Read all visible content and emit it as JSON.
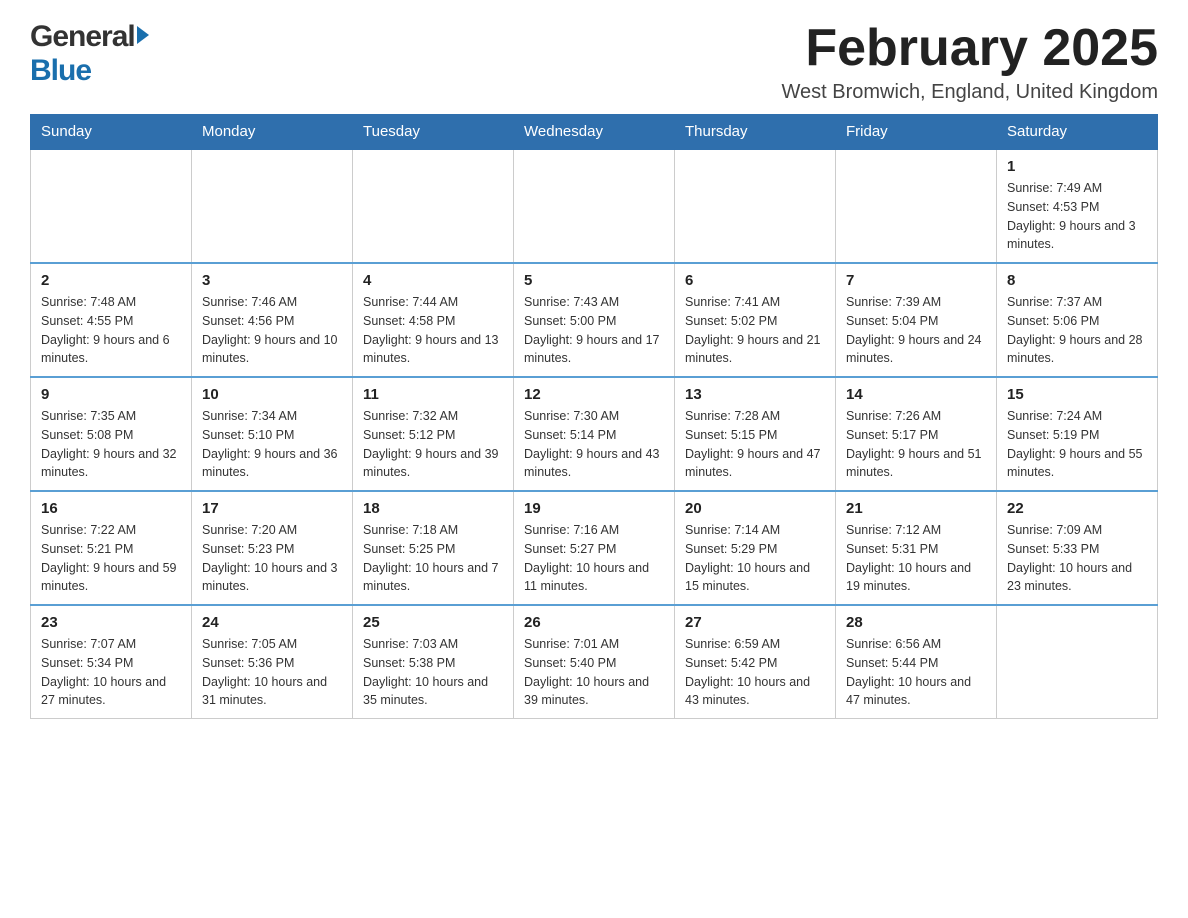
{
  "header": {
    "logo_general": "General",
    "logo_blue": "Blue",
    "month_title": "February 2025",
    "location": "West Bromwich, England, United Kingdom"
  },
  "days_of_week": [
    "Sunday",
    "Monday",
    "Tuesday",
    "Wednesday",
    "Thursday",
    "Friday",
    "Saturday"
  ],
  "weeks": [
    {
      "days": [
        {
          "number": "",
          "info": ""
        },
        {
          "number": "",
          "info": ""
        },
        {
          "number": "",
          "info": ""
        },
        {
          "number": "",
          "info": ""
        },
        {
          "number": "",
          "info": ""
        },
        {
          "number": "",
          "info": ""
        },
        {
          "number": "1",
          "info": "Sunrise: 7:49 AM\nSunset: 4:53 PM\nDaylight: 9 hours and 3 minutes."
        }
      ]
    },
    {
      "days": [
        {
          "number": "2",
          "info": "Sunrise: 7:48 AM\nSunset: 4:55 PM\nDaylight: 9 hours and 6 minutes."
        },
        {
          "number": "3",
          "info": "Sunrise: 7:46 AM\nSunset: 4:56 PM\nDaylight: 9 hours and 10 minutes."
        },
        {
          "number": "4",
          "info": "Sunrise: 7:44 AM\nSunset: 4:58 PM\nDaylight: 9 hours and 13 minutes."
        },
        {
          "number": "5",
          "info": "Sunrise: 7:43 AM\nSunset: 5:00 PM\nDaylight: 9 hours and 17 minutes."
        },
        {
          "number": "6",
          "info": "Sunrise: 7:41 AM\nSunset: 5:02 PM\nDaylight: 9 hours and 21 minutes."
        },
        {
          "number": "7",
          "info": "Sunrise: 7:39 AM\nSunset: 5:04 PM\nDaylight: 9 hours and 24 minutes."
        },
        {
          "number": "8",
          "info": "Sunrise: 7:37 AM\nSunset: 5:06 PM\nDaylight: 9 hours and 28 minutes."
        }
      ]
    },
    {
      "days": [
        {
          "number": "9",
          "info": "Sunrise: 7:35 AM\nSunset: 5:08 PM\nDaylight: 9 hours and 32 minutes."
        },
        {
          "number": "10",
          "info": "Sunrise: 7:34 AM\nSunset: 5:10 PM\nDaylight: 9 hours and 36 minutes."
        },
        {
          "number": "11",
          "info": "Sunrise: 7:32 AM\nSunset: 5:12 PM\nDaylight: 9 hours and 39 minutes."
        },
        {
          "number": "12",
          "info": "Sunrise: 7:30 AM\nSunset: 5:14 PM\nDaylight: 9 hours and 43 minutes."
        },
        {
          "number": "13",
          "info": "Sunrise: 7:28 AM\nSunset: 5:15 PM\nDaylight: 9 hours and 47 minutes."
        },
        {
          "number": "14",
          "info": "Sunrise: 7:26 AM\nSunset: 5:17 PM\nDaylight: 9 hours and 51 minutes."
        },
        {
          "number": "15",
          "info": "Sunrise: 7:24 AM\nSunset: 5:19 PM\nDaylight: 9 hours and 55 minutes."
        }
      ]
    },
    {
      "days": [
        {
          "number": "16",
          "info": "Sunrise: 7:22 AM\nSunset: 5:21 PM\nDaylight: 9 hours and 59 minutes."
        },
        {
          "number": "17",
          "info": "Sunrise: 7:20 AM\nSunset: 5:23 PM\nDaylight: 10 hours and 3 minutes."
        },
        {
          "number": "18",
          "info": "Sunrise: 7:18 AM\nSunset: 5:25 PM\nDaylight: 10 hours and 7 minutes."
        },
        {
          "number": "19",
          "info": "Sunrise: 7:16 AM\nSunset: 5:27 PM\nDaylight: 10 hours and 11 minutes."
        },
        {
          "number": "20",
          "info": "Sunrise: 7:14 AM\nSunset: 5:29 PM\nDaylight: 10 hours and 15 minutes."
        },
        {
          "number": "21",
          "info": "Sunrise: 7:12 AM\nSunset: 5:31 PM\nDaylight: 10 hours and 19 minutes."
        },
        {
          "number": "22",
          "info": "Sunrise: 7:09 AM\nSunset: 5:33 PM\nDaylight: 10 hours and 23 minutes."
        }
      ]
    },
    {
      "days": [
        {
          "number": "23",
          "info": "Sunrise: 7:07 AM\nSunset: 5:34 PM\nDaylight: 10 hours and 27 minutes."
        },
        {
          "number": "24",
          "info": "Sunrise: 7:05 AM\nSunset: 5:36 PM\nDaylight: 10 hours and 31 minutes."
        },
        {
          "number": "25",
          "info": "Sunrise: 7:03 AM\nSunset: 5:38 PM\nDaylight: 10 hours and 35 minutes."
        },
        {
          "number": "26",
          "info": "Sunrise: 7:01 AM\nSunset: 5:40 PM\nDaylight: 10 hours and 39 minutes."
        },
        {
          "number": "27",
          "info": "Sunrise: 6:59 AM\nSunset: 5:42 PM\nDaylight: 10 hours and 43 minutes."
        },
        {
          "number": "28",
          "info": "Sunrise: 6:56 AM\nSunset: 5:44 PM\nDaylight: 10 hours and 47 minutes."
        },
        {
          "number": "",
          "info": ""
        }
      ]
    }
  ]
}
